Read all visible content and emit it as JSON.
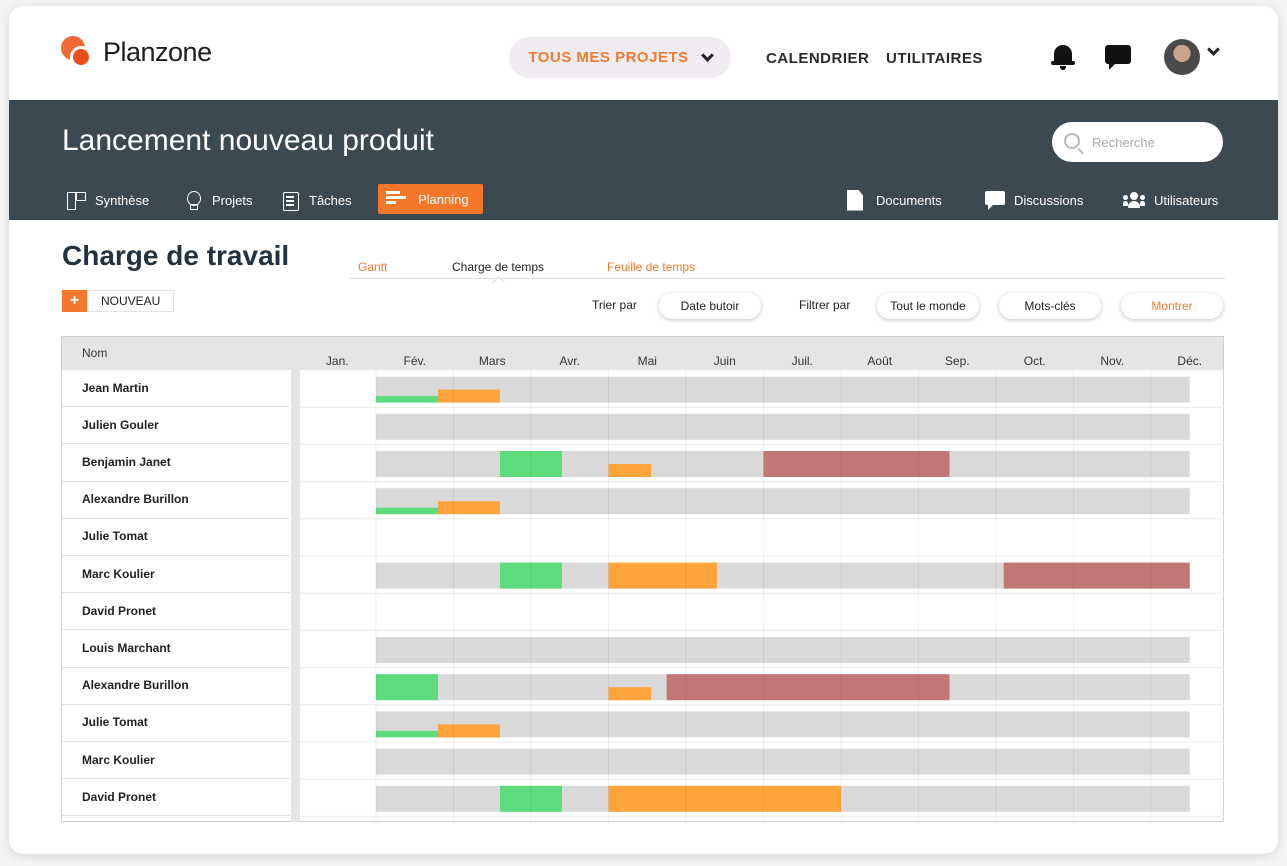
{
  "app": {
    "name": "Planzone"
  },
  "topnav": {
    "projects_label": "TOUS MES PROJETS",
    "calendar_label": "CALENDRIER",
    "utilities_label": "UTILITAIRES"
  },
  "project": {
    "title": "Lancement nouveau produit",
    "search_placeholder": "Recherche"
  },
  "project_tabs": {
    "synthese": "Synthèse",
    "projets": "Projets",
    "taches": "Tâches",
    "planning": "Planning",
    "documents": "Documents",
    "discussions": "Discussions",
    "utilisateurs": "Utilisateurs"
  },
  "page": {
    "title": "Charge de travail",
    "new_label": "NOUVEAU",
    "new_plus": "+"
  },
  "content_tabs": {
    "gantt": "Gantt",
    "charge": "Charge de temps",
    "feuille": "Feuille de temps"
  },
  "filters": {
    "sort_label": "Trier par",
    "sort_value": "Date butoir",
    "filter_label": "Filtrer par",
    "filter_value": "Tout le monde",
    "keywords": "Mots-clés",
    "show": "Montrer"
  },
  "colors": {
    "accent": "#f4762a",
    "header_bg": "#3b4a52",
    "bar_base": "#d9d9d9",
    "green": "#5ddc7e",
    "orange": "#ffa33a",
    "red": "#c27676"
  },
  "grid": {
    "name_header": "Nom",
    "months": [
      "Jan.",
      "Fév.",
      "Mars",
      "Avr.",
      "Mai",
      "Juin",
      "Juil.",
      "Août",
      "Sep.",
      "Oct.",
      "Nov.",
      "Déc."
    ],
    "rows": [
      {
        "name": "Jean Martin",
        "base": true,
        "segments": [
          {
            "color": "green",
            "start": 1.0,
            "end": 1.8,
            "level": 0.25
          },
          {
            "color": "orange",
            "start": 1.8,
            "end": 2.6,
            "level": 0.5
          }
        ]
      },
      {
        "name": "Julien Gouler",
        "base": true,
        "segments": []
      },
      {
        "name": "Benjamin Janet",
        "base": true,
        "segments": [
          {
            "color": "green",
            "start": 2.6,
            "end": 3.4,
            "level": 1.0
          },
          {
            "color": "orange",
            "start": 4.0,
            "end": 4.55,
            "level": 0.5
          },
          {
            "color": "red",
            "start": 6.0,
            "end": 8.4,
            "level": 1.0
          }
        ]
      },
      {
        "name": "Alexandre Burillon",
        "base": true,
        "segments": [
          {
            "color": "green",
            "start": 1.0,
            "end": 1.8,
            "level": 0.25
          },
          {
            "color": "orange",
            "start": 1.8,
            "end": 2.6,
            "level": 0.5
          }
        ]
      },
      {
        "name": "Julie Tomat",
        "base": false,
        "segments": []
      },
      {
        "name": "Marc Koulier",
        "base": true,
        "segments": [
          {
            "color": "green",
            "start": 2.6,
            "end": 3.4,
            "level": 1.0
          },
          {
            "color": "orange",
            "start": 4.0,
            "end": 5.4,
            "level": 1.0
          },
          {
            "color": "red",
            "start": 9.1,
            "end": 11.5,
            "level": 1.0
          }
        ]
      },
      {
        "name": "David Pronet",
        "base": false,
        "segments": []
      },
      {
        "name": "Louis Marchant",
        "base": true,
        "segments": []
      },
      {
        "name": "Alexandre Burillon",
        "base": true,
        "segments": [
          {
            "color": "green",
            "start": 1.0,
            "end": 1.8,
            "level": 1.0
          },
          {
            "color": "orange",
            "start": 4.0,
            "end": 4.55,
            "level": 0.5
          },
          {
            "color": "red",
            "start": 4.75,
            "end": 8.4,
            "level": 1.0
          }
        ]
      },
      {
        "name": "Julie Tomat",
        "base": true,
        "segments": [
          {
            "color": "green",
            "start": 1.0,
            "end": 1.8,
            "level": 0.25
          },
          {
            "color": "orange",
            "start": 1.8,
            "end": 2.6,
            "level": 0.5
          }
        ]
      },
      {
        "name": "Marc Koulier",
        "base": true,
        "segments": []
      },
      {
        "name": "David Pronet",
        "base": true,
        "segments": [
          {
            "color": "green",
            "start": 2.6,
            "end": 3.4,
            "level": 1.0
          },
          {
            "color": "orange",
            "start": 4.0,
            "end": 7.0,
            "level": 1.0
          }
        ]
      }
    ]
  }
}
